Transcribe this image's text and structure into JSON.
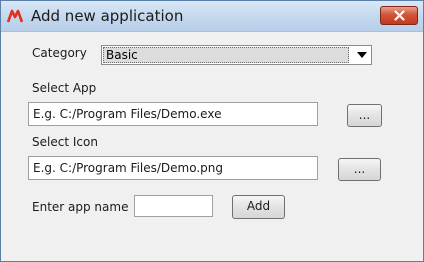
{
  "window": {
    "title": "Add new application",
    "app_icon": "microchip-logo-icon",
    "close_icon": "close-icon",
    "accent": "#c4391d"
  },
  "form": {
    "category_label": "Category",
    "category_value": "Basic",
    "select_app_label": "Select App",
    "select_app_placeholder": "E.g. C:/Program Files/Demo.exe",
    "browse_app_label": "...",
    "select_icon_label": "Select Icon",
    "select_icon_placeholder": "E.g. C:/Program Files/Demo.png",
    "browse_icon_label": "...",
    "app_name_label": "Enter app name",
    "app_name_value": "",
    "add_label": "Add"
  }
}
